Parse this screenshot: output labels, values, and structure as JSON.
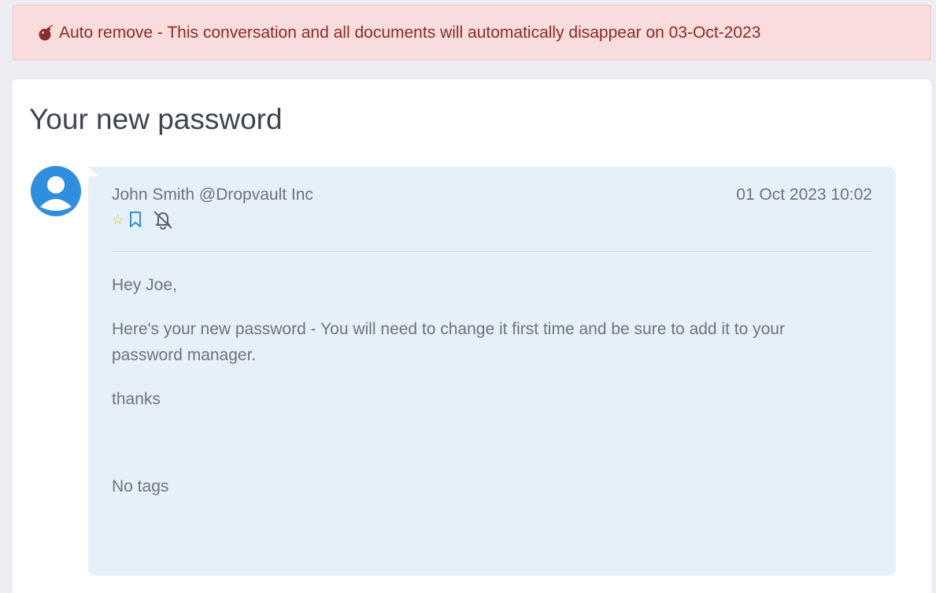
{
  "alert": {
    "icon": "bomb-icon",
    "text": "Auto remove - This conversation and all documents will automatically disappear on 03-Oct-2023"
  },
  "page": {
    "title": "Your new password"
  },
  "message": {
    "avatar_icon": "user-avatar-icon",
    "sender": "John Smith @Dropvault Inc",
    "date": "01 Oct 2023 10:02",
    "actions": [
      "star-icon",
      "bookmark-icon",
      "bell-off-icon"
    ],
    "greeting": "Hey Joe,",
    "paragraph": "Here's your new password - You will need to change it first time and be sure to add it to your password manager.",
    "signoff": "thanks",
    "tags": "No tags"
  },
  "colors": {
    "alert_bg": "#f9dcdc",
    "alert_text": "#8a2a2a",
    "message_bg": "#e6f0fa",
    "avatar": "#2f8fde",
    "star": "#e6b800",
    "bookmark": "#2f8fde"
  }
}
